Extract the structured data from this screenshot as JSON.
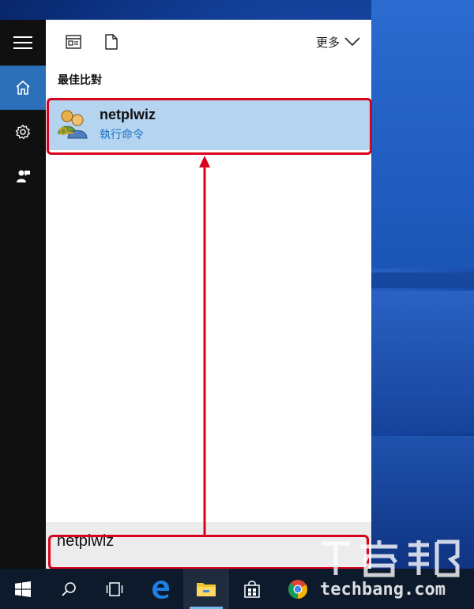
{
  "start_menu": {
    "more_label": "更多",
    "section_label": "最佳比對",
    "best_match": {
      "name": "netplwiz",
      "type": "執行命令"
    },
    "search": {
      "value": "netplwiz"
    }
  },
  "rail_icons": [
    "hamburger-menu-icon",
    "home-icon",
    "settings-gear-icon",
    "feedback-icon"
  ],
  "taskbar_icons": [
    "windows-start-icon",
    "search-icon",
    "task-view-icon",
    "edge-icon",
    "file-explorer-icon",
    "store-icon",
    "chrome-icon"
  ],
  "watermark": {
    "text": "techbang.com",
    "logo_text": "T客邦"
  },
  "colors": {
    "accent": "#2a6fb8",
    "selection": "#b4d4f0",
    "highlight_box": "#d9001b",
    "subtitle": "#1c6fc4"
  }
}
